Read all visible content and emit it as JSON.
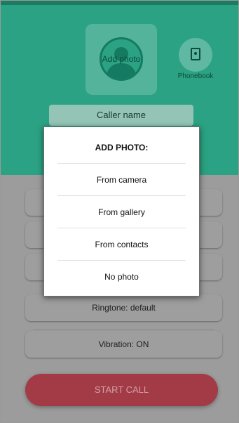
{
  "header": {
    "photo_button_label": "Add photo",
    "phonebook_label": "Phonebook"
  },
  "form": {
    "caller_name_placeholder": "Caller name",
    "ringtone_label": "Ringtone: default",
    "vibration_label": "Vibration: ON",
    "start_call_label": "START CALL"
  },
  "dialog": {
    "title": "ADD PHOTO:",
    "options": [
      {
        "label": "From camera"
      },
      {
        "label": "From gallery"
      },
      {
        "label": "From contacts"
      },
      {
        "label": "No photo"
      }
    ]
  },
  "colors": {
    "header_green": "#2aa283",
    "start_call_red": "#a33b47",
    "scrim": "#9c9c9c"
  }
}
